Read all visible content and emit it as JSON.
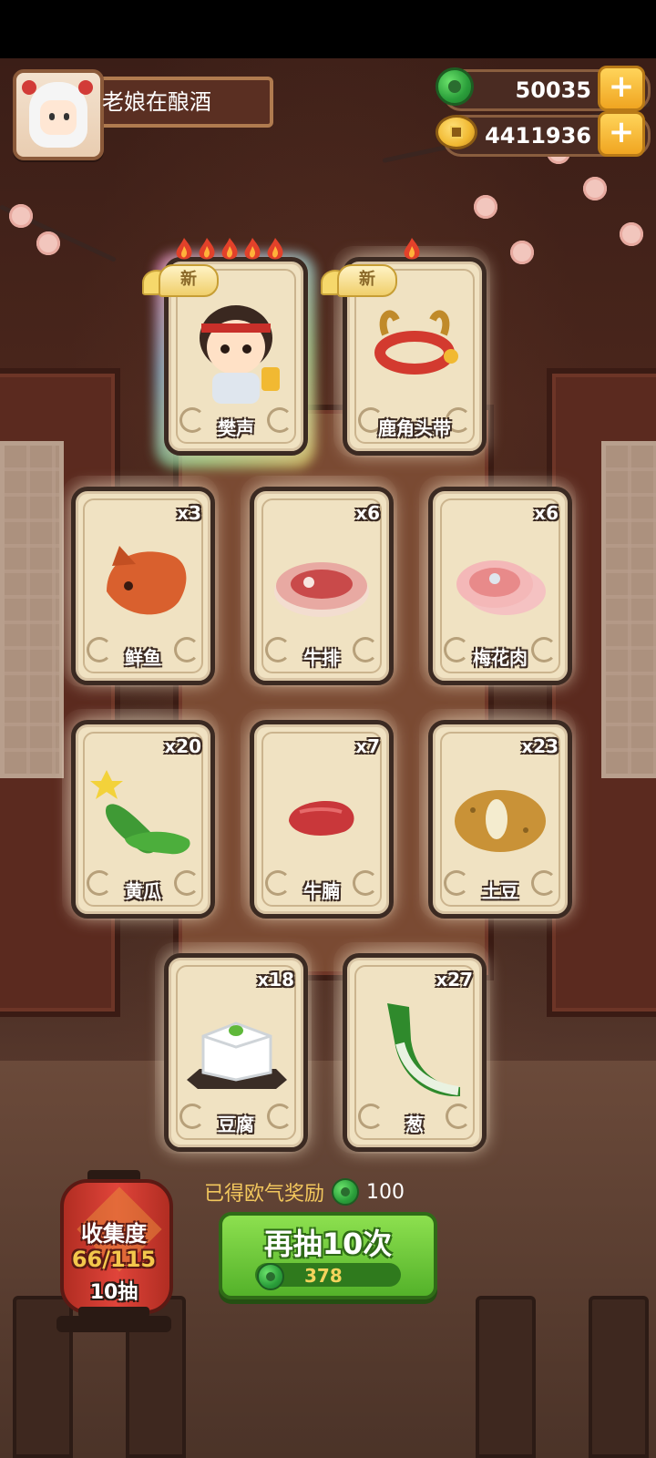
{
  "player": {
    "name": "老娘在酿酒"
  },
  "currency": {
    "jade": "50035",
    "coins": "4411936",
    "plus": "+"
  },
  "new_badge": "新",
  "featured_cards": [
    {
      "label": "樊声",
      "new": true,
      "flames": 5,
      "kind": "character"
    },
    {
      "label": "鹿角头带",
      "new": true,
      "flames": 1,
      "kind": "item"
    }
  ],
  "cards": [
    {
      "label": "鲜鱼",
      "count": "x3",
      "icon": "fish-icon"
    },
    {
      "label": "牛排",
      "count": "x6",
      "icon": "steak-icon"
    },
    {
      "label": "梅花肉",
      "count": "x6",
      "icon": "pork-icon"
    },
    {
      "label": "黄瓜",
      "count": "x20",
      "icon": "cucumber-icon"
    },
    {
      "label": "牛腩",
      "count": "x7",
      "icon": "brisket-icon"
    },
    {
      "label": "土豆",
      "count": "x23",
      "icon": "potato-icon"
    },
    {
      "label": "豆腐",
      "count": "x18",
      "icon": "tofu-icon"
    },
    {
      "label": "葱",
      "count": "x27",
      "icon": "scallion-icon"
    }
  ],
  "luck_reward": {
    "label": "已得欧气奖励",
    "value": "100"
  },
  "redraw": {
    "label": "再抽10次",
    "cost": "378"
  },
  "collection": {
    "title": "收集度",
    "progress": "66/115",
    "draws": "10抽"
  },
  "colors": {
    "accent_green": "#54b22a",
    "gold": "#f2c75d",
    "card_bg": "#f0e2c2"
  }
}
